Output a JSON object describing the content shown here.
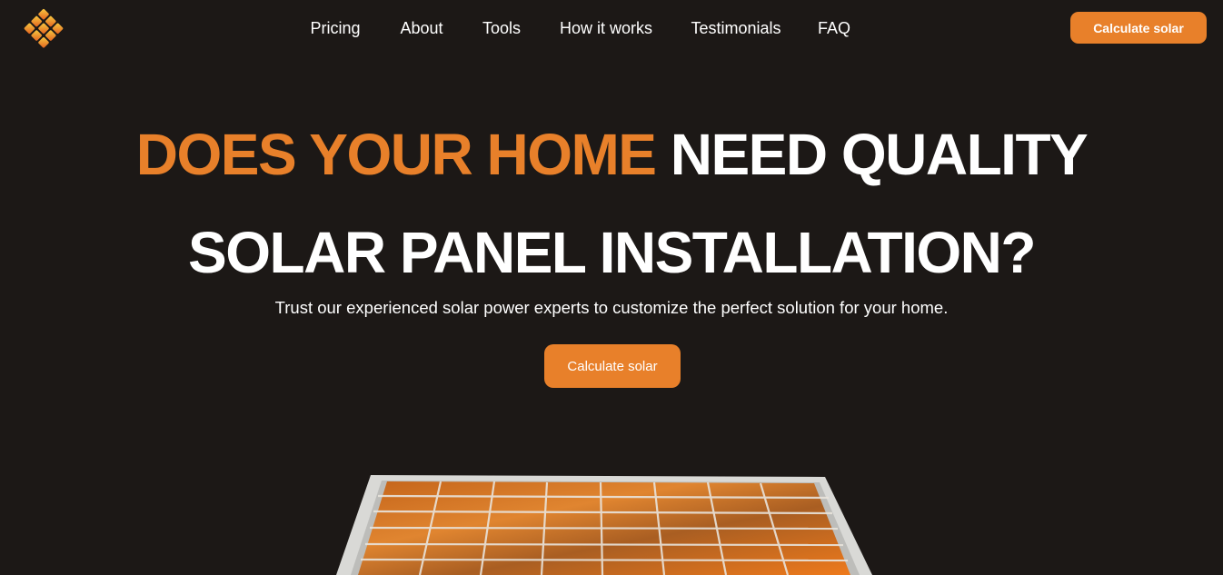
{
  "brand": {
    "logo_icon": "orange-diamond-grid-logo",
    "accent_color": "#e8802a"
  },
  "nav": {
    "items": [
      {
        "label": "Pricing"
      },
      {
        "label": "About"
      },
      {
        "label": "Tools"
      },
      {
        "label": "How it works"
      },
      {
        "label": "Testimonials"
      },
      {
        "label": "FAQ"
      }
    ],
    "cta_label": "Calculate solar"
  },
  "hero": {
    "title_line1_accent": "DOES YOUR HOME",
    "title_line1_rest": "NEED QUALITY",
    "title_line2": "SOLAR PANEL INSTALLATION?",
    "subtitle": "Trust our experienced solar power experts to customize the perfect solution for your home.",
    "cta_label": "Calculate solar",
    "image_icon": "solar-panel-image"
  },
  "colors": {
    "background": "#1c1816",
    "accent": "#e8802a",
    "text": "#ffffff"
  }
}
